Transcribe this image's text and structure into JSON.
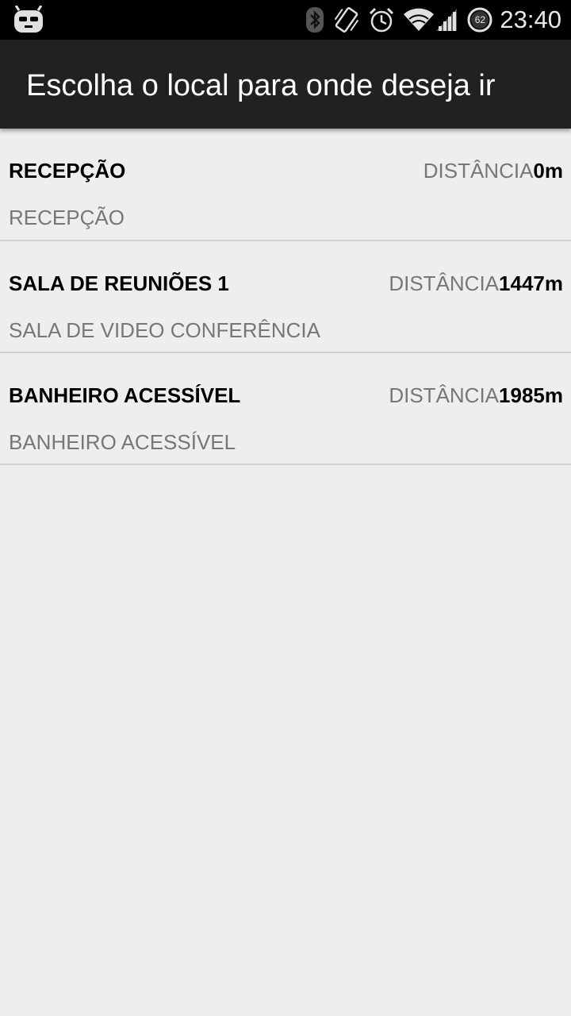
{
  "status_bar": {
    "time": "23:40",
    "battery_level": "62",
    "icons": [
      "cyanogenmod-bugdroid-icon",
      "bluetooth-icon",
      "vibrate-icon",
      "alarm-icon",
      "wifi-icon",
      "cell-signal-icon",
      "battery-icon"
    ]
  },
  "action_bar": {
    "title": "Escolha o local para onde deseja ir",
    "background": "#212121"
  },
  "list": {
    "items": [
      {
        "title": "RECEPÇÃO",
        "subtitle": "RECEPÇÃO",
        "distance_label": "DISTÂNCIA",
        "distance_value": "0m"
      },
      {
        "title": "SALA DE REUNIÕES 1",
        "subtitle": "SALA DE VIDEO CONFERÊNCIA",
        "distance_label": "DISTÂNCIA",
        "distance_value": "1447m"
      },
      {
        "title": "BANHEIRO ACESSÍVEL",
        "subtitle": "BANHEIRO ACESSÍVEL",
        "distance_label": "DISTÂNCIA",
        "distance_value": "1985m"
      }
    ]
  }
}
